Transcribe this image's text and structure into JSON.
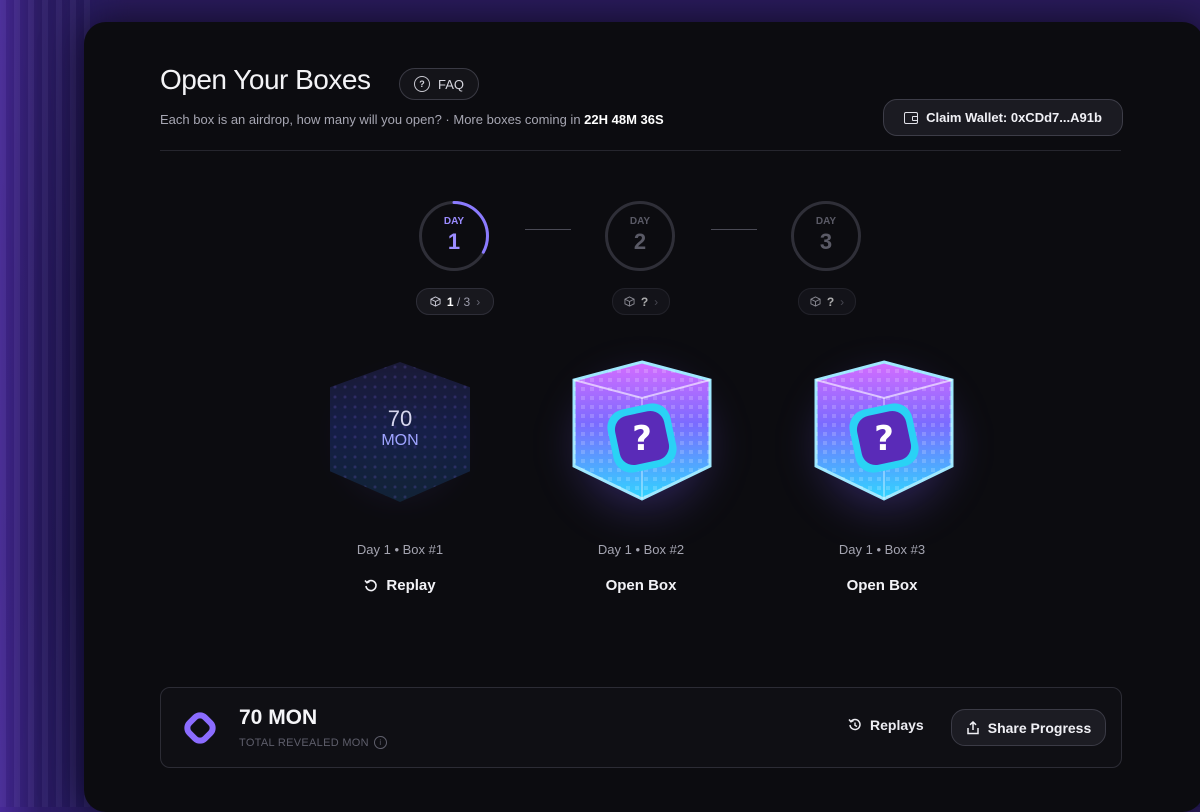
{
  "page": {
    "title": "Open Your Boxes",
    "faq_label": "FAQ",
    "subtitle_prefix": "Each box is an airdrop, how many will you open? · More boxes coming in ",
    "countdown": "22H 48M 36S",
    "claim_wallet_label": "Claim Wallet: 0xCDd7...A91b"
  },
  "days": [
    {
      "small": "DAY",
      "num": "1",
      "progress": 0.33,
      "pill_count": "1",
      "pill_total": "/ 3"
    },
    {
      "small": "DAY",
      "num": "2",
      "pill_count": "?"
    },
    {
      "small": "DAY",
      "num": "3",
      "pill_count": "?"
    }
  ],
  "boxes": [
    {
      "reveal_value": "70",
      "reveal_unit": "MON",
      "label": "Day 1 • Box #1",
      "action": "Replay"
    },
    {
      "label": "Day 1 • Box #2",
      "action": "Open Box"
    },
    {
      "label": "Day 1 • Box #3",
      "action": "Open Box"
    }
  ],
  "footer": {
    "total_value": "70 MON",
    "total_label": "TOTAL REVEALED MON",
    "replays_label": "Replays",
    "share_label": "Share Progress"
  },
  "colors": {
    "accent": "#8b7bff",
    "panel_bg": "#0c0c10"
  }
}
